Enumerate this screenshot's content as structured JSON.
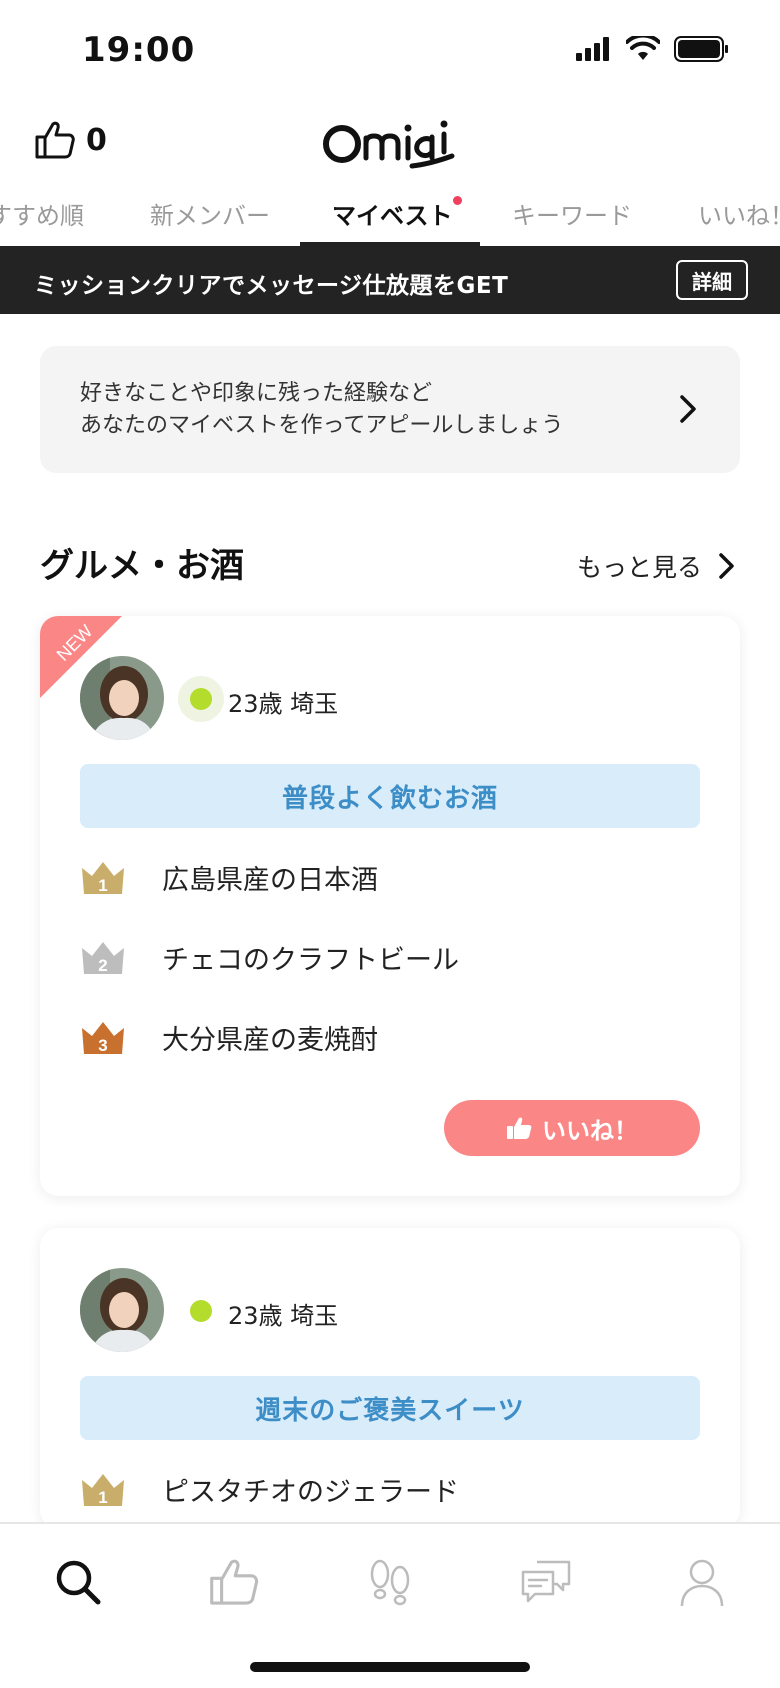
{
  "status_bar": {
    "time": "19:00"
  },
  "header": {
    "like_count": "0",
    "logo_text": "Omiai"
  },
  "tabs": [
    {
      "label": "すすめ順",
      "active": false
    },
    {
      "label": "新メンバー",
      "active": false
    },
    {
      "label": "マイベスト",
      "active": true,
      "has_dot": true
    },
    {
      "label": "キーワード",
      "active": false
    },
    {
      "label": "いいね！",
      "active": false
    }
  ],
  "banner": {
    "text": "ミッションクリアでメッセージ仕放題をGET",
    "button_label": "詳細"
  },
  "prompt": {
    "line1": "好きなことや印象に残った経験など",
    "line2": "あなたのマイベストを作ってアピールしましょう"
  },
  "section": {
    "title": "グルメ・お酒",
    "see_more": "もっと見る"
  },
  "cards": [
    {
      "badge": "NEW",
      "age_area": "23歳 埼玉",
      "topic": "普段よく飲むお酒",
      "ranks": [
        "広島県産の日本酒",
        "チェコのクラフトビール",
        "大分県産の麦焼酎"
      ],
      "like_label": "いいね！"
    },
    {
      "age_area": "23歳 埼玉",
      "topic": "週末のご褒美スイーツ",
      "ranks": [
        "ピスタチオのジェラード"
      ]
    }
  ],
  "rank_numbers": [
    "1",
    "2",
    "3"
  ],
  "colors": {
    "accent_pink": "#fb8686",
    "online_green": "#b4dc2c",
    "topic_bg": "#d8ecfa",
    "topic_text": "#3d8dc7",
    "crown_gold": "#c9ad6a",
    "crown_silver": "#bdbdbd",
    "crown_bronze": "#c8702e"
  },
  "bottom_nav": [
    {
      "icon": "search-icon",
      "active": true
    },
    {
      "icon": "thumbs-up-icon",
      "active": false
    },
    {
      "icon": "footprints-icon",
      "active": false
    },
    {
      "icon": "messages-icon",
      "active": false
    },
    {
      "icon": "profile-icon",
      "active": false
    }
  ]
}
